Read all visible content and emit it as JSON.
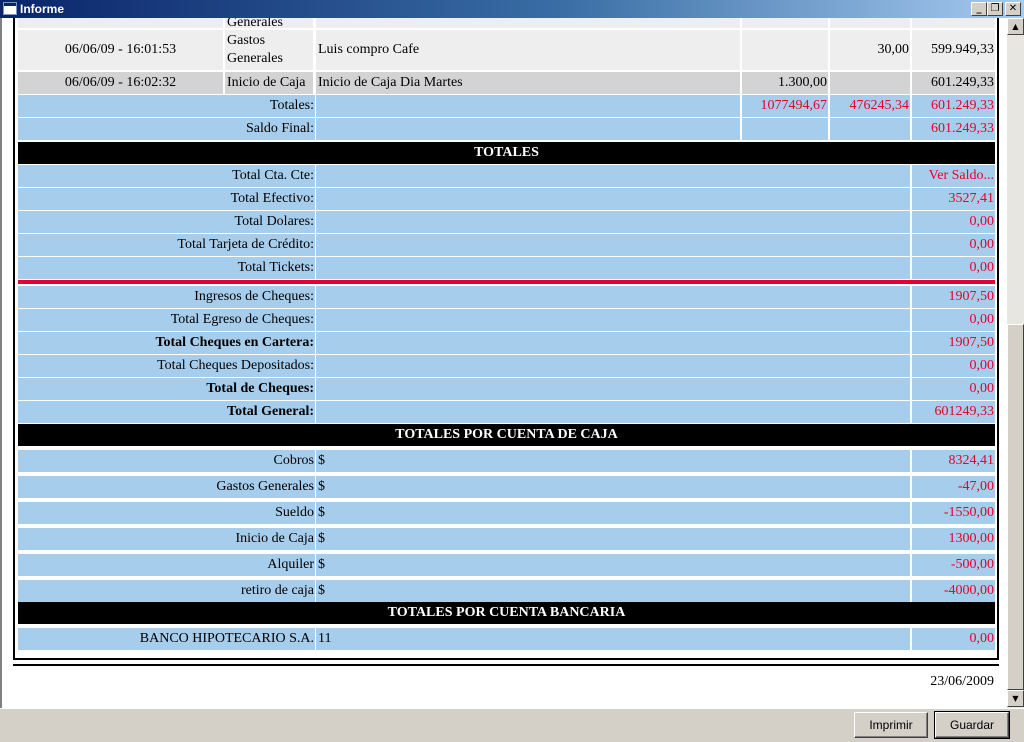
{
  "window": {
    "title": "Informe",
    "min_glyph": "_",
    "max_glyph": "❐",
    "close_glyph": "✕"
  },
  "detail": {
    "partial_type": "Generales",
    "rows": [
      {
        "date": "06/06/09 - 16:01:53",
        "type": "Gastos Generales",
        "description": "Luis compro Cafe",
        "ingreso": "",
        "egreso": "30,00",
        "saldo": "599.949,33"
      },
      {
        "date": "06/06/09 - 16:02:32",
        "type": "Inicio de Caja",
        "description": "Inicio de Caja Dia Martes",
        "ingreso": "1.300,00",
        "egreso": "",
        "saldo": "601.249,33"
      }
    ],
    "totales": {
      "label": "Totales:",
      "ingresos": "1077494,67",
      "egresos": "476245,34",
      "saldo": "601.249,33"
    },
    "saldo_final": {
      "label": "Saldo Final:",
      "value": "601.249,33"
    }
  },
  "totales": {
    "header": "TOTALES",
    "group1": [
      {
        "label": "Total Cta. Cte:",
        "value": "Ver Saldo..."
      },
      {
        "label": "Total Efectivo:",
        "value": "3527,41"
      },
      {
        "label": "Total Dolares:",
        "value": "0,00"
      },
      {
        "label": "Total Tarjeta de Crédito:",
        "value": "0,00"
      },
      {
        "label": "Total Tickets:",
        "value": "0,00"
      }
    ],
    "group2": [
      {
        "label": "Ingresos de Cheques:",
        "value": "1907,50"
      },
      {
        "label": "Total Egreso de Cheques:",
        "value": "0,00"
      },
      {
        "label": "Total Cheques en Cartera:",
        "value": "1907,50"
      },
      {
        "label": "Total Cheques Depositados:",
        "value": "0,00"
      },
      {
        "label": "Total de Cheques:",
        "value": "0,00"
      },
      {
        "label": "Total General:",
        "value": "601249,33"
      }
    ]
  },
  "cuenta_caja": {
    "header": "TOTALES POR CUENTA DE CAJA",
    "rows": [
      {
        "label": "Cobros",
        "currency": "$",
        "value": "8324,41"
      },
      {
        "label": "Gastos Generales",
        "currency": "$",
        "value": "-47,00"
      },
      {
        "label": "Sueldo",
        "currency": "$",
        "value": "-1550,00"
      },
      {
        "label": "Inicio de Caja",
        "currency": "$",
        "value": "1300,00"
      },
      {
        "label": "Alquiler",
        "currency": "$",
        "value": "-500,00"
      },
      {
        "label": "retiro de caja",
        "currency": "$",
        "value": "-4000,00"
      }
    ]
  },
  "cuenta_bancaria": {
    "header": "TOTALES POR CUENTA BANCARIA",
    "rows": [
      {
        "label": "BANCO HIPOTECARIO S.A.",
        "account": "11",
        "value": "0,00"
      }
    ]
  },
  "footer": {
    "date": "23/06/2009"
  },
  "buttons": {
    "print": "Imprimir",
    "save": "Guardar"
  },
  "scrollbar": {
    "up_glyph": "▲",
    "down_glyph": "▼"
  }
}
